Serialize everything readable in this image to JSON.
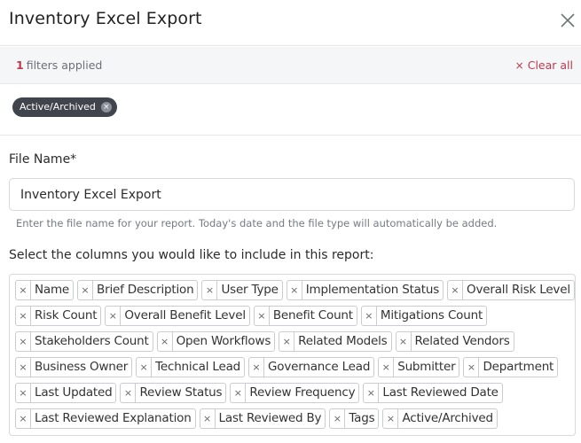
{
  "dialog": {
    "title": "Inventory Excel Export"
  },
  "filters": {
    "count": "1",
    "count_suffix": "filters applied",
    "clear_label": "Clear all",
    "chips": [
      "Active/Archived"
    ]
  },
  "file_name": {
    "label": "File Name*",
    "value": "Inventory Excel Export",
    "help": "Enter the file name for your report. Today's date and the file type will automatically be added."
  },
  "columns": {
    "label": "Select the columns you would like to include in this report:",
    "rows": [
      [
        "Name",
        "Brief Description",
        "User Type",
        "Implementation Status",
        "Overall Risk Level"
      ],
      [
        "Risk Count",
        "Overall Benefit Level",
        "Benefit Count",
        "Mitigations Count"
      ],
      [
        "Stakeholders Count",
        "Open Workflows",
        "Related Models",
        "Related Vendors"
      ],
      [
        "Business Owner",
        "Technical Lead",
        "Governance Lead",
        "Submitter",
        "Department"
      ],
      [
        "Last Updated",
        "Review Status",
        "Review Frequency",
        "Last Reviewed Date"
      ],
      [
        "Last Reviewed Explanation",
        "Last Reviewed By",
        "Tags",
        "Active/Archived"
      ]
    ]
  },
  "icons": {
    "close": "close-icon",
    "remove": "remove-x-icon"
  },
  "colors": {
    "accent_red": "#c0394b",
    "chip_dark": "#40454d"
  }
}
